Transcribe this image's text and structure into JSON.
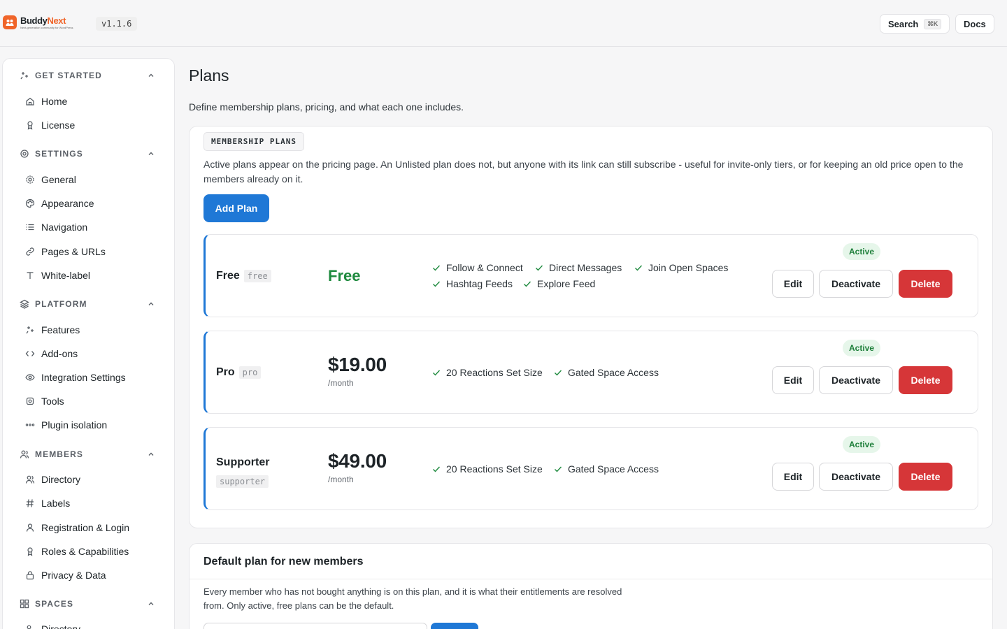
{
  "app": {
    "brand_first": "Buddy",
    "brand_second": "Next",
    "tagline": "Next-generation community for WordPress",
    "version": "v1.1.6"
  },
  "topbar": {
    "search_label": "Search",
    "search_shortcut": "⌘K",
    "docs_label": "Docs"
  },
  "sidebar": {
    "sections": [
      {
        "title": "GET STARTED",
        "items": [
          "Home",
          "License"
        ]
      },
      {
        "title": "SETTINGS",
        "items": [
          "General",
          "Appearance",
          "Navigation",
          "Pages & URLs",
          "White-label"
        ]
      },
      {
        "title": "PLATFORM",
        "items": [
          "Features",
          "Add-ons",
          "Integration Settings",
          "Tools",
          "Plugin isolation"
        ]
      },
      {
        "title": "MEMBERS",
        "items": [
          "Directory",
          "Labels",
          "Registration & Login",
          "Roles & Capabilities",
          "Privacy & Data"
        ]
      },
      {
        "title": "SPACES",
        "items": [
          "Directory"
        ]
      }
    ]
  },
  "page": {
    "title": "Plans",
    "description": "Define membership plans, pricing, and what each one includes."
  },
  "plans_card": {
    "tag": "MEMBERSHIP PLANS",
    "text": "Active plans appear on the pricing page. An Unlisted plan does not, but anyone with its link can still subscribe - useful for invite-only tiers, or for keeping an old price open to the members already on it.",
    "add_label": "Add Plan"
  },
  "plans": [
    {
      "name": "Free",
      "slug": "free",
      "price": "Free",
      "period": "",
      "features": [
        "Follow & Connect",
        "Direct Messages",
        "Join Open Spaces",
        "Hashtag Feeds",
        "Explore Feed"
      ],
      "status": "Active",
      "edit": "Edit",
      "deactivate": "Deactivate",
      "delete": "Delete"
    },
    {
      "name": "Pro",
      "slug": "pro",
      "price": "$19.00",
      "period": "/month",
      "features": [
        "20 Reactions Set Size",
        "Gated Space Access"
      ],
      "status": "Active",
      "edit": "Edit",
      "deactivate": "Deactivate",
      "delete": "Delete"
    },
    {
      "name": "Supporter",
      "slug": "supporter",
      "price": "$49.00",
      "period": "/month",
      "features": [
        "20 Reactions Set Size",
        "Gated Space Access"
      ],
      "status": "Active",
      "edit": "Edit",
      "deactivate": "Deactivate",
      "delete": "Delete"
    }
  ],
  "default_card": {
    "title": "Default plan for new members",
    "text": "Every member who has not bought anything is on this plan, and it is what their entitlements are resolved from. Only active, free plans can be the default."
  },
  "colors": {
    "accent": "#1f78d6",
    "danger": "#d63638",
    "success": "#1e8a3e",
    "brand": "#f0652a"
  }
}
